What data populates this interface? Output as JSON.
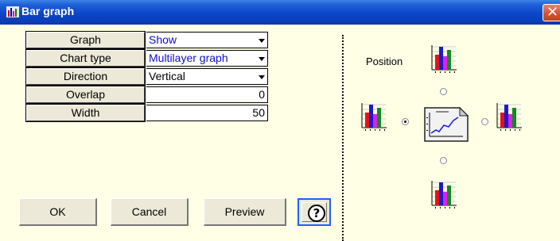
{
  "window": {
    "title": "Bar graph",
    "icon": "bar-chart-icon",
    "close_icon": "close-icon"
  },
  "properties": [
    {
      "label": "Graph",
      "value": "Show",
      "type": "dropdown"
    },
    {
      "label": "Chart type",
      "value": "Multilayer graph",
      "type": "dropdown"
    },
    {
      "label": "Direction",
      "value": "Vertical",
      "type": "dropdown"
    },
    {
      "label": "Overlap",
      "value": "0",
      "type": "number"
    },
    {
      "label": "Width",
      "value": "50",
      "type": "number"
    }
  ],
  "buttons": {
    "ok": "OK",
    "cancel": "Cancel",
    "preview": "Preview",
    "help_icon": "help-icon",
    "help_glyph": "?"
  },
  "position": {
    "label": "Position",
    "options": [
      "top",
      "left",
      "right",
      "bottom"
    ],
    "selected": "left"
  },
  "colors": {
    "titlebar": "#0b46c8",
    "background": "#ffffe6",
    "accent_value_text": "#1010c0"
  }
}
